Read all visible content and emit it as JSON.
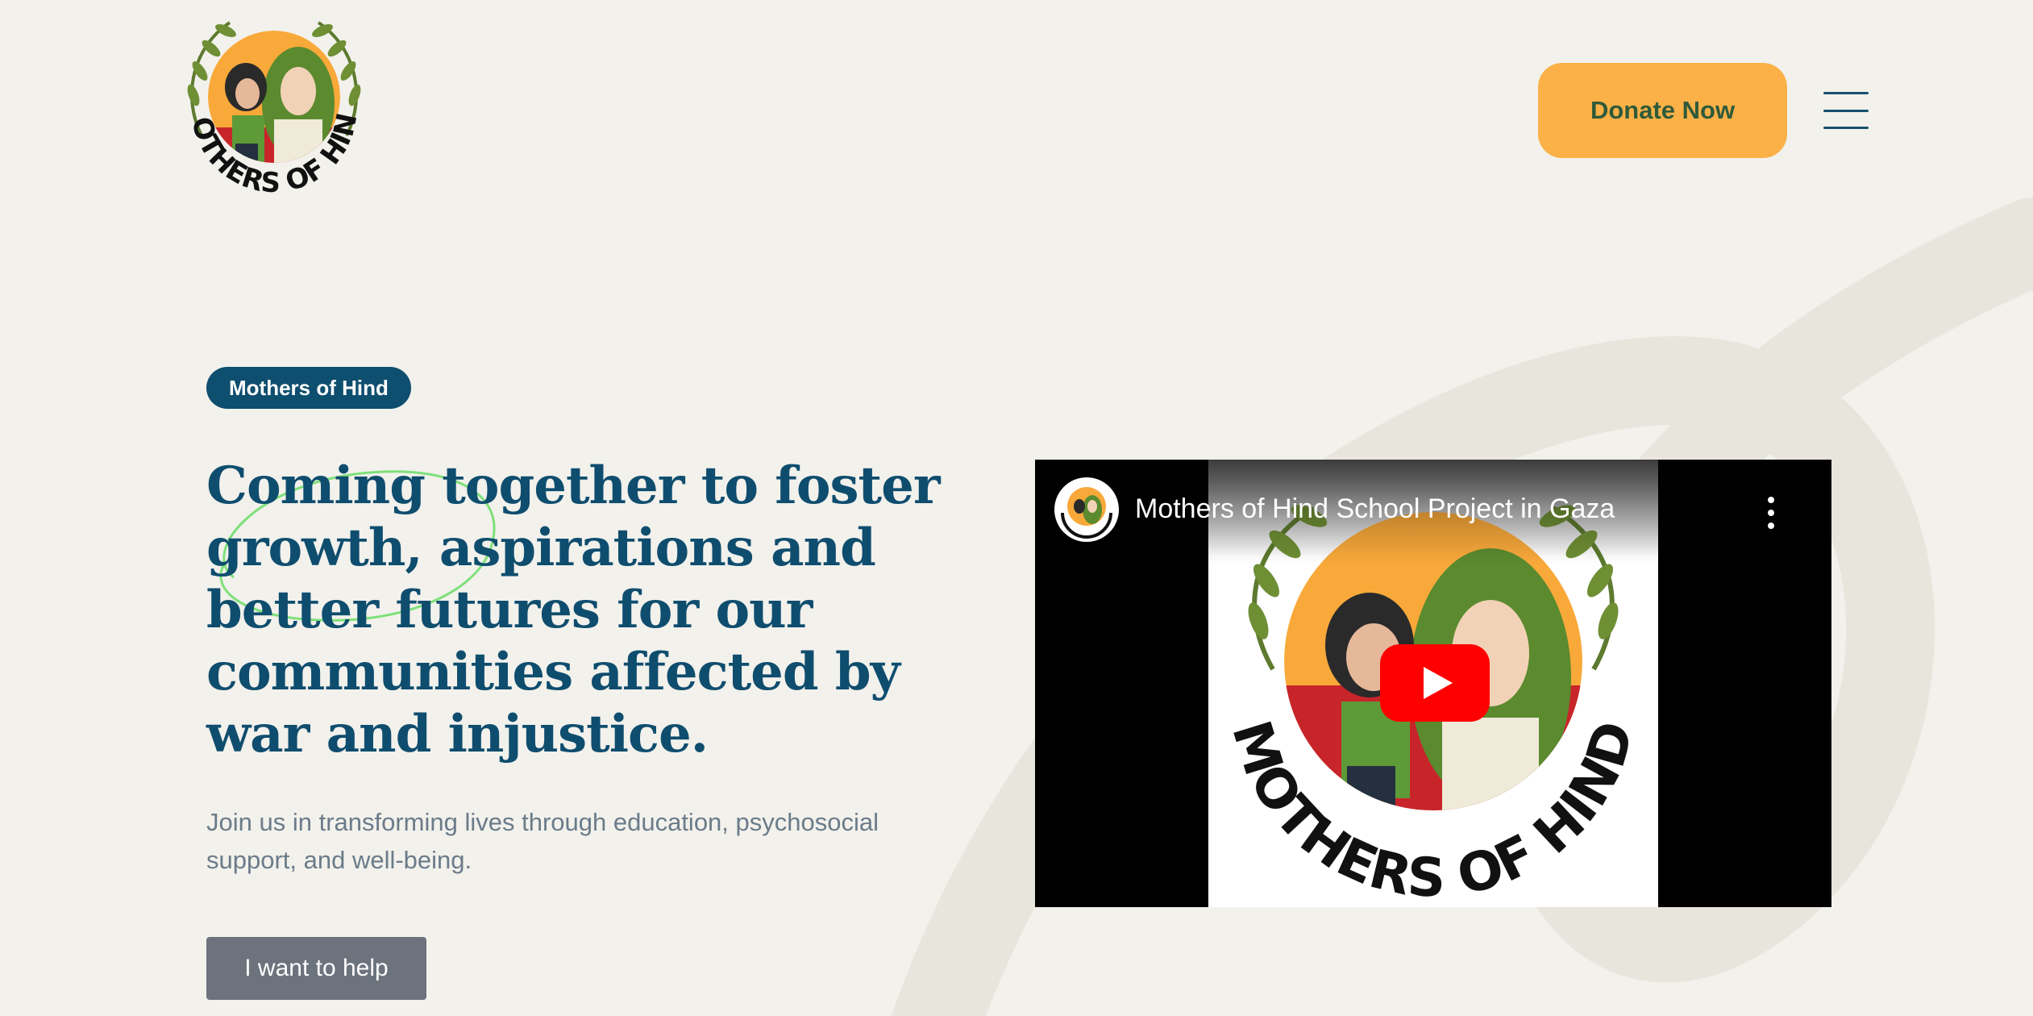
{
  "header": {
    "logo_text": "MOTHERS OF HIND",
    "donate_label": "Donate Now",
    "menu_icon": "hamburger-menu-icon"
  },
  "hero": {
    "badge": "Mothers of Hind",
    "headline_lines": [
      "Coming together to foster",
      "growth, aspirations and",
      "better futures for our",
      "communities affected by",
      "war and injustice."
    ],
    "subtext_lines": [
      "Join us in transforming lives through education, psychosocial",
      "support, and well-being."
    ],
    "cta_label": "I want to help"
  },
  "video": {
    "title": "Mothers of Hind School Project in Gaza",
    "thumbnail_text": "MOTHERS OF HIND",
    "play_icon": "youtube-play-icon",
    "more_icon": "more-vertical-icon"
  },
  "colors": {
    "background": "#f2f1ec",
    "primary": "#0f4d6e",
    "accent": "#fbb147",
    "button_gray": "#6c737d",
    "youtube_red": "#ff0000",
    "scribble_green": "#7fe07a"
  }
}
